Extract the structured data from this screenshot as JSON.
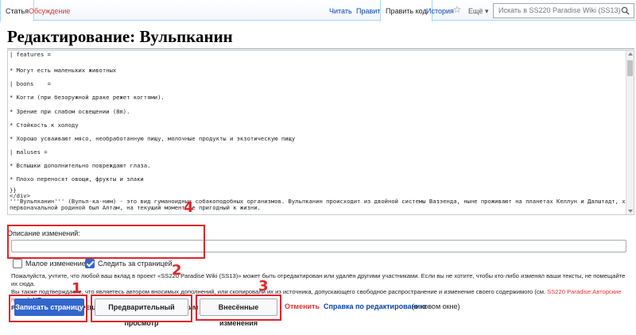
{
  "tabs": {
    "article": "Статья",
    "discussion": "Обсуждение",
    "read": "Читать",
    "edit": "Править",
    "edit_code": "Править код",
    "history": "История",
    "more": "Ещё",
    "search_placeholder": "Искать в SS220 Paradise Wiki (SS13)"
  },
  "page": {
    "title": "Редактирование: Вульпканин"
  },
  "editor": {
    "lines": [
      "| features =",
      "* Могут есть маленьких животных",
      "| boons    =",
      "* Когти (при безоружной драке режет когтями).",
      "* Зрение при слабом освещении (8m).",
      "* Стойкость к холоду",
      "* Хорошо усваивают мясо, необработанную пищу, молочные продукты и экзотическую пищу",
      "| maluses =",
      "* Вспышки дополнительно повреждают глаза.",
      "* Плохо переносят овощи, фрукты и злаки",
      "}}",
      "</div>",
      "'''Вульпканин''' (Вульп-ка-ним) - это вид гуманоидных собакоподобных организмов. Вульпканин происходит из двойной системы Вазэенда, ныне проживают на планетах Келлун и Далштадт, хотя их",
      "первоначальной родиной был Алтам, на текущий момент не пригодный к жизни."
    ]
  },
  "summary": {
    "label": "Описание изменений:"
  },
  "options": {
    "minor_label": "Малое изменение",
    "watch_label": "Следить за страницей"
  },
  "legal": {
    "line1": "Пожалуйста, учтите, что любой ваш вклад в проект «SS220 Paradise Wiki (SS13)» может быть отредактирован или удалён другими участниками. Если вы не хотите, чтобы кто-либо изменял ваши тексты, не помещайте их сюда.",
    "line2a": "Вы также подтверждаете, что являетесь автором вносимых дополнений, или скопировали их из источника, допускающего свободное распространение и изменение своего содержимого (см. ",
    "link": "SS220 Paradise:Авторские права",
    "line2b": "). ",
    "bold1": "НЕ",
    "bold2": "РАЗМЕЩАЙТЕ БЕЗ РАЗРЕШЕНИЯ ОХРАНЯЕМЫЕ АВТОРСКИМ ПРАВОМ МАТЕРИАЛЫ!"
  },
  "actions": {
    "save": "Записать страницу",
    "preview": "Предварительный просмотр",
    "diff": "Внесённые изменения",
    "cancel": "Отменить",
    "help": "Справка по редактированию",
    "help_note": "(в новом окне)"
  },
  "annotations": [
    "1",
    "2",
    "3",
    "4"
  ],
  "colors": {
    "annotation": "#e0242b",
    "primary": "#3366cc",
    "link": "#0645ad",
    "new_link": "#dd3333"
  }
}
